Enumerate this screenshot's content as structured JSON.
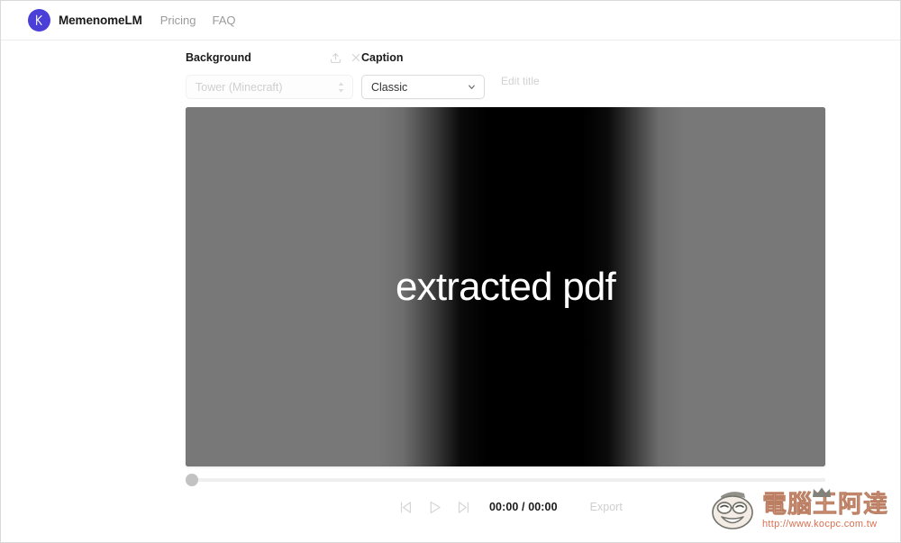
{
  "nav": {
    "logo_icon": "memenome-logo-icon",
    "brand": "MemenomeLM",
    "links": [
      {
        "label": "Pricing"
      },
      {
        "label": "FAQ"
      }
    ]
  },
  "editor": {
    "background": {
      "label": "Background",
      "select_value": "Tower (Minecraft)",
      "stepper_icon": "chevron-up-down-icon",
      "upload_icon": "upload-icon",
      "clear_icon": "close-icon"
    },
    "caption": {
      "label": "Caption",
      "select_value": "Classic",
      "chevron_icon": "chevron-down-icon",
      "options": [
        "Classic"
      ]
    },
    "title": {
      "edit_label": "Edit title"
    },
    "preview": {
      "caption_text": "extracted pdf",
      "background_left_color": "#787878",
      "background_center_color": "#000000",
      "caption_color": "#ffffff"
    },
    "timeline": {
      "position_percent": 0,
      "thumb_color": "#c2c2c2",
      "track_color": "#efefef"
    },
    "transport": {
      "skip_back_icon": "skip-to-start-icon",
      "play_icon": "play-icon",
      "skip_forward_icon": "skip-to-end-icon",
      "current_time": "00:00",
      "separator": "/",
      "total_time": "00:00",
      "time_display": "00:00 / 00:00",
      "export_label": "Export"
    }
  },
  "watermark": {
    "title": "電腦王阿達",
    "url": "http://www.kocpc.com.tw",
    "mascot_icon": "mascot-face-icon",
    "crown_icon": "crown-icon",
    "title_color": "#d8a38a",
    "url_color": "#d86a4a"
  }
}
